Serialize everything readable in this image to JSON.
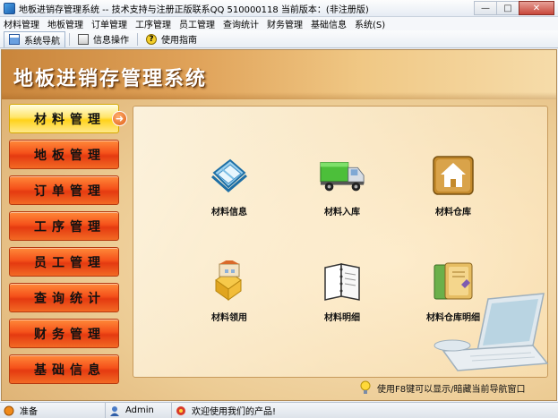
{
  "window": {
    "title": "地板进销存管理系统 -- 技术支持与注册正版联系QQ 510000118   当前版本：(非注册版)",
    "minimize": "—",
    "maximize": "□",
    "close": "✕"
  },
  "menu": [
    "材料管理",
    "地板管理",
    "订单管理",
    "工序管理",
    "员工管理",
    "查询统计",
    "财务管理",
    "基础信息",
    "系统(S)"
  ],
  "toolbar": {
    "nav": "系统导航",
    "info": "信息操作",
    "help": "使用指南"
  },
  "banner": {
    "title": "地板进销存管理系统"
  },
  "sidenav": [
    {
      "label": "材料管理",
      "active": true
    },
    {
      "label": "地板管理",
      "active": false
    },
    {
      "label": "订单管理",
      "active": false
    },
    {
      "label": "工序管理",
      "active": false
    },
    {
      "label": "员工管理",
      "active": false
    },
    {
      "label": "查询统计",
      "active": false
    },
    {
      "label": "财务管理",
      "active": false
    },
    {
      "label": "基础信息",
      "active": false
    }
  ],
  "sidenav_arrow": "➜",
  "tiles": [
    {
      "label": "材料信息",
      "icon": "material-info-icon"
    },
    {
      "label": "材料入库",
      "icon": "truck-icon"
    },
    {
      "label": "材料仓库",
      "icon": "warehouse-house-icon"
    },
    {
      "label": "材料领用",
      "icon": "material-issue-icon"
    },
    {
      "label": "材料明细",
      "icon": "notebook-icon"
    },
    {
      "label": "材料仓库明细",
      "icon": "ledger-book-icon"
    }
  ],
  "hint": "使用F8键可以显示/暗藏当前导航窗口",
  "statusbar": {
    "ready": "准备",
    "user": "Admin",
    "welcome": "欢迎使用我们的产品!"
  },
  "colors": {
    "nav_button": "#f5511a",
    "nav_button_active": "#ffd21a",
    "banner": "#d99a4e"
  }
}
